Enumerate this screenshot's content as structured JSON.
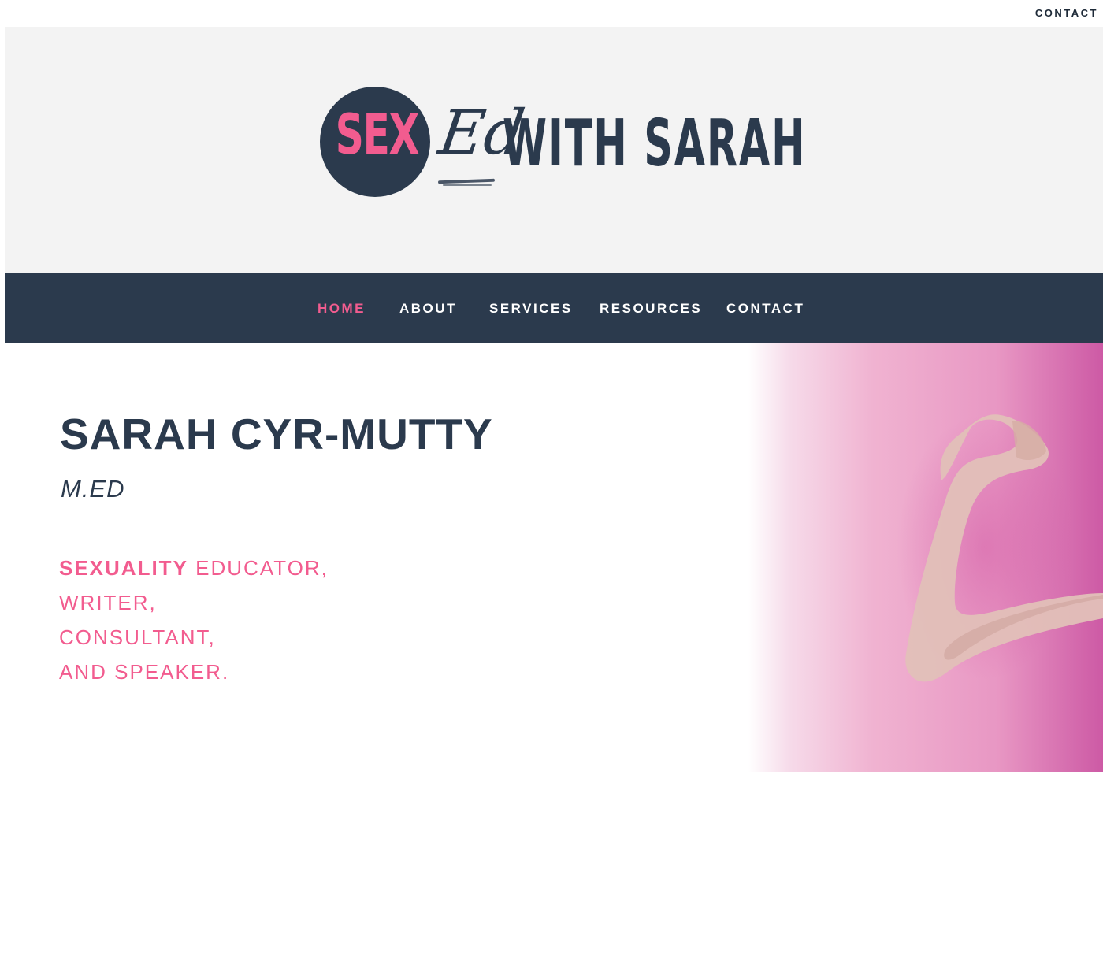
{
  "topbar": {
    "contact_link": "CONTACT"
  },
  "logo": {
    "sex": "SEX",
    "ed": "Ed",
    "with_sarah": "WITH SARAH"
  },
  "nav": {
    "items": [
      {
        "label": "HOME",
        "active": true
      },
      {
        "label": "ABOUT"
      },
      {
        "label": "SERVICES"
      },
      {
        "label": "RESOURCES"
      },
      {
        "label": "CONTACT"
      }
    ]
  },
  "hero": {
    "name": "SARAH CYR-MUTTY",
    "credential": "M.ED",
    "tagline": {
      "line1_bold": "SEXUALITY",
      "line1_rest": " EDUCATOR,",
      "line2": "WRITER,",
      "line3": "CONSULTANT,",
      "line4": "AND SPEAKER."
    },
    "image_description_icon": "flexed-arm-image"
  },
  "colors": {
    "navy": "#2b3a4d",
    "pink": "#f25c8f",
    "header_bg": "#f3f3f3"
  }
}
